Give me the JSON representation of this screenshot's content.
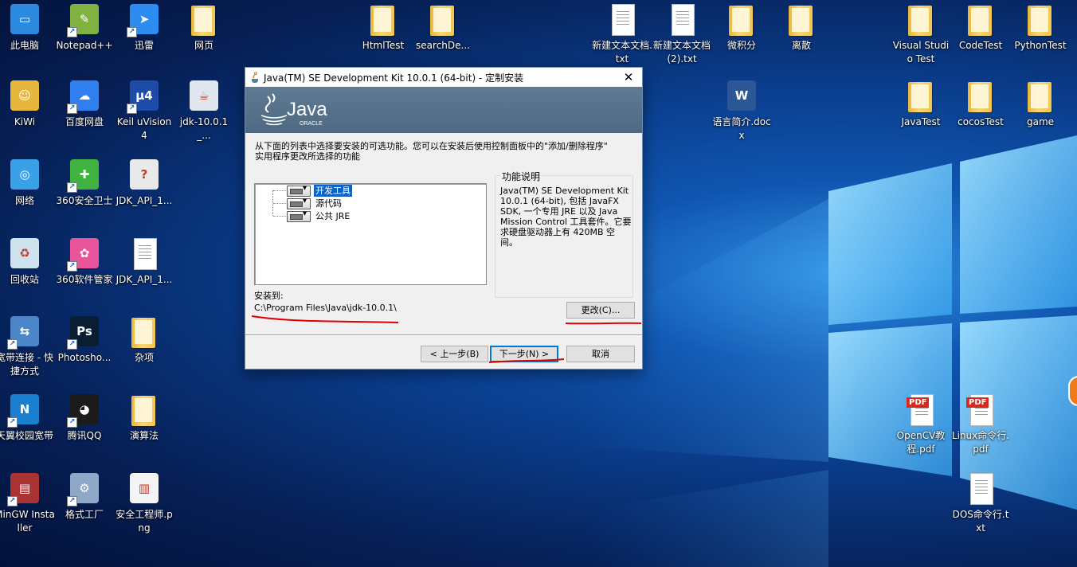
{
  "desktop": {
    "icons": [
      {
        "label": "此电脑",
        "icon": "computer-icon",
        "shortcut": false
      },
      {
        "label": "Notepad++",
        "icon": "notepad-icon",
        "shortcut": true
      },
      {
        "label": "迅雷",
        "icon": "thunder-icon",
        "shortcut": true
      },
      {
        "label": "网页",
        "icon": "folder-icon",
        "shortcut": false
      },
      {
        "label": "HtmlTest",
        "icon": "folder-icon",
        "shortcut": false
      },
      {
        "label": "searchDe...",
        "icon": "folder-icon",
        "shortcut": false
      },
      {
        "label": "新建文本文档.txt",
        "icon": "text-file-icon",
        "shortcut": false
      },
      {
        "label": "新建文本文档 (2).txt",
        "icon": "text-file-icon",
        "shortcut": false
      },
      {
        "label": "微积分",
        "icon": "folder-icon",
        "shortcut": false
      },
      {
        "label": "离散",
        "icon": "folder-icon",
        "shortcut": false
      },
      {
        "label": "Visual Studio Test",
        "icon": "folder-icon",
        "shortcut": false
      },
      {
        "label": "CodeTest",
        "icon": "folder-icon",
        "shortcut": false
      },
      {
        "label": "PythonTest",
        "icon": "folder-icon",
        "shortcut": false
      },
      {
        "label": "KiWi",
        "icon": "user-folder-icon",
        "shortcut": false
      },
      {
        "label": "百度网盘",
        "icon": "baidu-netdisk-icon",
        "shortcut": true
      },
      {
        "label": "Keil uVision4",
        "icon": "keil-icon",
        "shortcut": true
      },
      {
        "label": "jdk-10.0.1_...",
        "icon": "java-installer-icon",
        "shortcut": false
      },
      {
        "label": "语言简介.docx",
        "icon": "word-doc-icon",
        "shortcut": false
      },
      {
        "label": "JavaTest",
        "icon": "folder-icon",
        "shortcut": false
      },
      {
        "label": "cocosTest",
        "icon": "folder-icon",
        "shortcut": false
      },
      {
        "label": "game",
        "icon": "pdf-folder-icon",
        "shortcut": false
      },
      {
        "label": "网络",
        "icon": "network-icon",
        "shortcut": false
      },
      {
        "label": "360安全卫士",
        "icon": "security-360-icon",
        "shortcut": true
      },
      {
        "label": "JDK_API_1...",
        "icon": "help-file-icon",
        "shortcut": false
      },
      {
        "label": "回收站",
        "icon": "recycle-bin-icon",
        "shortcut": false
      },
      {
        "label": "360软件管家",
        "icon": "software-manager-icon",
        "shortcut": true
      },
      {
        "label": "JDK_API_1...",
        "icon": "blank-file-icon",
        "shortcut": false
      },
      {
        "label": "宽带连接 - 快捷方式",
        "icon": "broadband-icon",
        "shortcut": true
      },
      {
        "label": "Photosho...",
        "icon": "photoshop-icon",
        "shortcut": true
      },
      {
        "label": "杂项",
        "icon": "folder-icon",
        "shortcut": false
      },
      {
        "label": "天翼校园宽带",
        "icon": "tianyi-icon",
        "shortcut": true
      },
      {
        "label": "腾讯QQ",
        "icon": "qq-icon",
        "shortcut": true
      },
      {
        "label": "演算法",
        "icon": "folder-icon",
        "shortcut": false
      },
      {
        "label": "OpenCV教程.pdf",
        "icon": "pdf-file-icon",
        "shortcut": false
      },
      {
        "label": "Linux命令行.pdf",
        "icon": "pdf-file-icon",
        "shortcut": false
      },
      {
        "label": "MinGW Installer",
        "icon": "mingw-icon",
        "shortcut": true
      },
      {
        "label": "格式工厂",
        "icon": "format-factory-icon",
        "shortcut": true
      },
      {
        "label": "安全工程师.png",
        "icon": "image-file-icon",
        "shortcut": false
      },
      {
        "label": "DOS命令行.txt",
        "icon": "text-file-icon",
        "shortcut": false
      }
    ]
  },
  "dialog": {
    "title": "Java(TM) SE Development Kit 10.0.1 (64-bit) - 定制安装",
    "banner_logo": "Java",
    "banner_sub": "ORACLE",
    "intro_line1": "从下面的列表中选择要安装的可选功能。您可以在安装后使用控制面板中的\"添加/删除程序\"",
    "intro_line2": "实用程序更改所选择的功能",
    "features": [
      {
        "label": "开发工具",
        "selected": true
      },
      {
        "label": "源代码",
        "selected": false
      },
      {
        "label": "公共 JRE",
        "selected": false
      }
    ],
    "feature_desc_title": "功能说明",
    "feature_desc": "Java(TM) SE Development Kit 10.0.1 (64-bit), 包括 JavaFX SDK, 一个专用 JRE 以及 Java Mission Control 工具套件。它要求硬盘驱动器上有 420MB 空间。",
    "install_to_label": "安装到:",
    "install_path": "C:\\Program Files\\Java\\jdk-10.0.1\\",
    "change_button": "更改(C)...",
    "back_button": "< 上一步(B)",
    "next_button": "下一步(N) >",
    "cancel_button": "取消",
    "close_glyph": "✕"
  },
  "colors": {
    "selection": "#0a64c8",
    "annotation_red": "#e00000",
    "banner": "#56738b"
  }
}
